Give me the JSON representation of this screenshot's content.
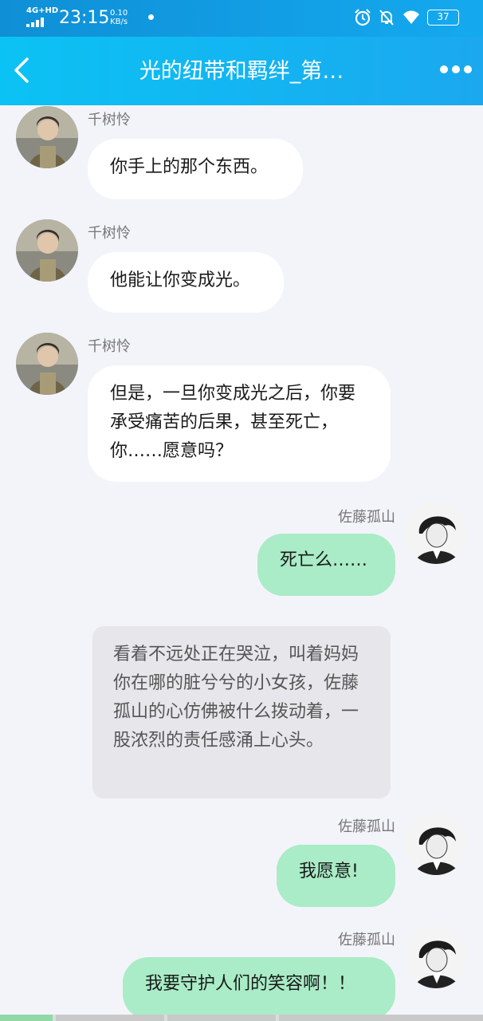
{
  "status_bar": {
    "network": "4G+HD",
    "time": "23:15",
    "speed_value": "0.10",
    "speed_unit": "KB/s",
    "battery": "37"
  },
  "nav": {
    "title": "光的纽带和羁绊_第…"
  },
  "characters": {
    "left_name": "千树怜",
    "right_name": "佐藤孤山"
  },
  "messages": [
    {
      "side": "left",
      "sender": "千树怜",
      "text": "你手上的那个东西。"
    },
    {
      "side": "left",
      "sender": "千树怜",
      "text": "他能让你变成光。"
    },
    {
      "side": "left",
      "sender": "千树怜",
      "text": "但是，一旦你变成光之后，你要承受痛苦的后果，甚至死亡，你……愿意吗？"
    },
    {
      "side": "right",
      "sender": "佐藤孤山",
      "text": "死亡么……"
    },
    {
      "side": "narration",
      "text": "看着不远处正在哭泣，叫着妈妈你在哪的脏兮兮的小女孩，佐藤孤山的心仿佛被什么拨动着，一股浓烈的责任感涌上心头。"
    },
    {
      "side": "right",
      "sender": "佐藤孤山",
      "text": "我愿意!"
    },
    {
      "side": "right",
      "sender": "佐藤孤山",
      "text": "我要守护人们的笑容啊！！"
    }
  ],
  "colors": {
    "nav_start": "#0bc2f4",
    "nav_end": "#1ba8ef",
    "left_bubble": "#ffffff",
    "right_bubble": "#a9ecc7",
    "narration_bg": "#e7e6ea",
    "chat_bg": "#f3f4f9"
  },
  "icons": {
    "back": "chevron-left-icon",
    "more": "more-dots-icon",
    "alarm": "alarm-icon",
    "mute": "bell-off-icon",
    "wifi": "wifi-icon"
  }
}
